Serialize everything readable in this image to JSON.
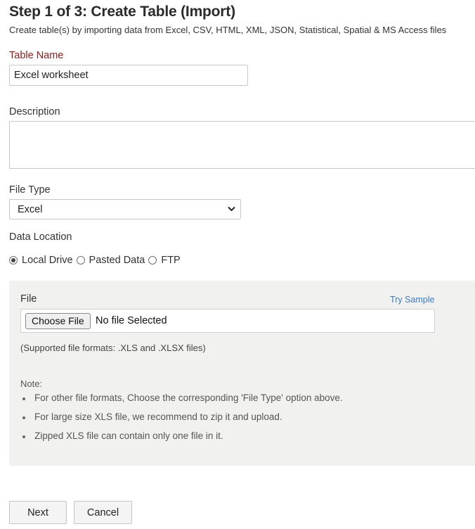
{
  "header": {
    "title": "Step 1 of 3: Create Table (Import)",
    "subtitle": "Create table(s) by importing data from Excel, CSV, HTML, XML, JSON, Statistical, Spatial & MS Access files"
  },
  "table_name": {
    "label": "Table Name",
    "value": "Excel worksheet"
  },
  "description": {
    "label": "Description",
    "value": ""
  },
  "file_type": {
    "label": "File Type",
    "selected": "Excel",
    "icon": "chevron-down-icon"
  },
  "data_location": {
    "label": "Data Location",
    "options": [
      "Local Drive",
      "Pasted Data",
      "FTP"
    ],
    "selected": "Local Drive"
  },
  "file_panel": {
    "label": "File",
    "try_sample": "Try Sample",
    "choose_button": "Choose File",
    "status": "No file Selected",
    "supported": "(Supported file formats: .XLS and .XLSX files)",
    "note_title": "Note:",
    "notes": [
      "For other file formats, Choose the corresponding 'File Type' option above.",
      "For large size XLS file, we recommend to zip it and upload.",
      "Zipped XLS file can contain only one file in it."
    ]
  },
  "actions": {
    "next": "Next",
    "cancel": "Cancel"
  },
  "colors": {
    "required_label": "#8b1a1a",
    "link": "#3a7cc4",
    "panel_bg": "#f1f1f0"
  }
}
